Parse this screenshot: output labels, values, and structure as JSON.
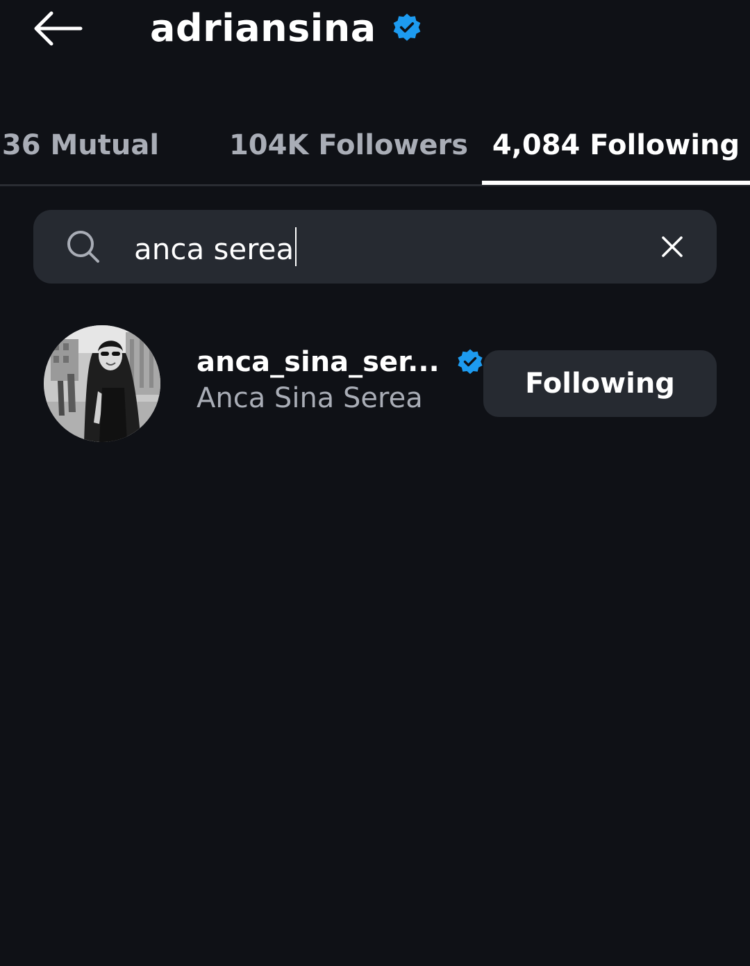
{
  "header": {
    "title": "adriansina",
    "back_icon": "arrow-left-icon",
    "verified_icon": "verified-badge-icon"
  },
  "tabs": [
    {
      "label": "36 Mutual",
      "active": false
    },
    {
      "label": "104K Followers",
      "active": false
    },
    {
      "label": "4,084 Following",
      "active": true
    }
  ],
  "search": {
    "value": "anca serea",
    "icon": "search-icon",
    "clear_icon": "close-icon"
  },
  "results": [
    {
      "username": "anca_sina_ser...",
      "full_name": "Anca Sina Serea",
      "verified": true,
      "button_label": "Following"
    }
  ],
  "colors": {
    "background": "#0f1116",
    "surface": "#262a31",
    "muted_text": "#a9adb6",
    "verified_blue": "#1d9bf0"
  }
}
